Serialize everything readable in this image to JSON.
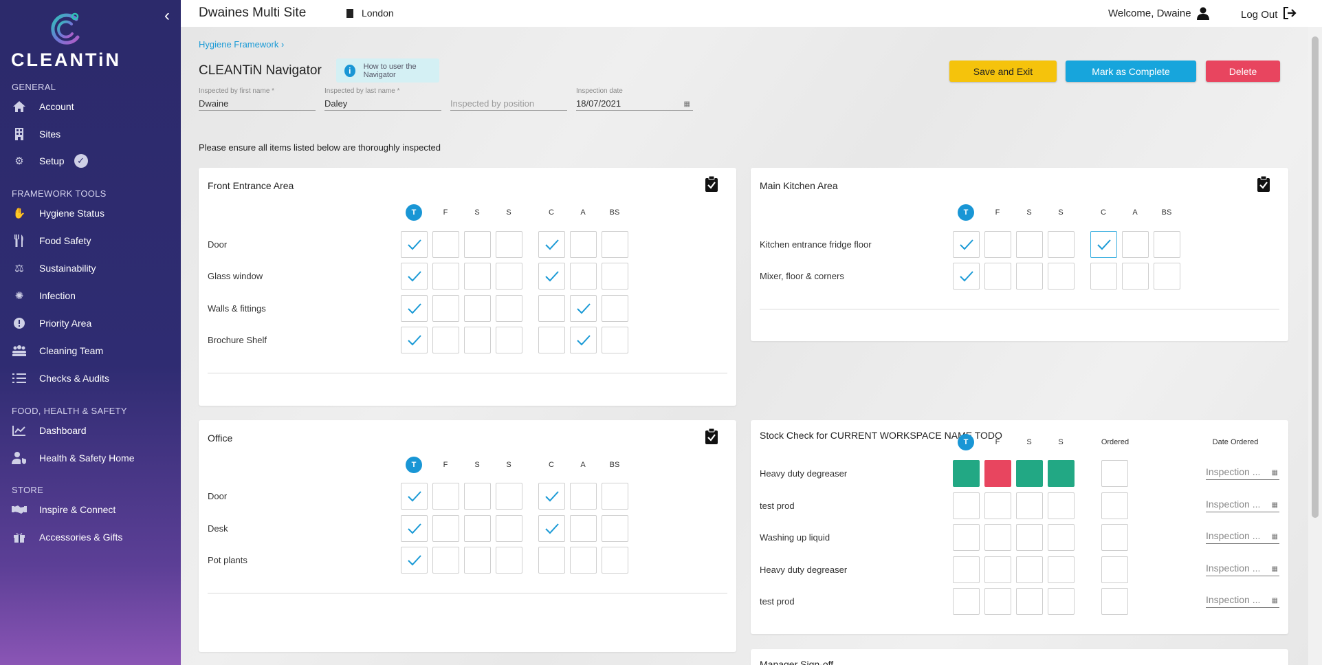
{
  "sidebar": {
    "brand": "CLEANTiN",
    "collapse_icon": "chevron-left-icon",
    "sections": [
      {
        "title": "GENERAL",
        "items": [
          {
            "label": "Account",
            "icon": "home-icon"
          },
          {
            "label": "Sites",
            "icon": "building-icon"
          },
          {
            "label": "Setup",
            "icon": "gear-icon",
            "badge_icon": "check-circle-icon"
          }
        ]
      },
      {
        "title": "FRAMEWORK TOOLS",
        "items": [
          {
            "label": "Hygiene Status",
            "icon": "hand-wash-icon"
          },
          {
            "label": "Food Safety",
            "icon": "cutlery-icon"
          },
          {
            "label": "Sustainability",
            "icon": "scales-icon"
          },
          {
            "label": "Infection",
            "icon": "virus-icon"
          },
          {
            "label": "Priority Area",
            "icon": "alert-icon"
          },
          {
            "label": "Cleaning Team",
            "icon": "team-icon"
          },
          {
            "label": "Checks & Audits",
            "icon": "checklist-icon"
          }
        ]
      },
      {
        "title": "FOOD, HEALTH & SAFETY",
        "items": [
          {
            "label": "Dashboard",
            "icon": "chart-icon"
          },
          {
            "label": "Health & Safety Home",
            "icon": "user-shield-icon"
          }
        ]
      },
      {
        "title": "STORE",
        "items": [
          {
            "label": "Inspire & Connect",
            "icon": "handshake-icon"
          },
          {
            "label": "Accessories & Gifts",
            "icon": "gift-icon"
          }
        ]
      }
    ]
  },
  "topbar": {
    "site_title": "Dwaines Multi Site",
    "location": "London",
    "welcome": "Welcome, Dwaine",
    "logout": "Log Out"
  },
  "page": {
    "breadcrumb": "Hygiene Framework",
    "title": "CLEANTiN Navigator",
    "howto": "How to user the Navigator",
    "buttons": {
      "save": "Save and Exit",
      "complete": "Mark as Complete",
      "delete": "Delete"
    },
    "fields": {
      "first_name": {
        "label": "Inspected by first name *",
        "value": "Dwaine"
      },
      "last_name": {
        "label": "Inspected by last name *",
        "value": "Daley"
      },
      "position": {
        "placeholder": "Inspected by position"
      },
      "date": {
        "label": "Inspection date",
        "value": "18/07/2021"
      }
    },
    "instruction": "Please ensure all items listed below are thoroughly inspected"
  },
  "columns": [
    "T",
    "F",
    "S",
    "S",
    "C",
    "A",
    "BS"
  ],
  "areas": {
    "front": {
      "title": "Front Entrance Area",
      "rows": [
        {
          "label": "Door",
          "checks": [
            1,
            0,
            0,
            0,
            1,
            0,
            0
          ]
        },
        {
          "label": "Glass window",
          "checks": [
            1,
            0,
            0,
            0,
            1,
            0,
            0
          ]
        },
        {
          "label": "Walls & fittings",
          "checks": [
            1,
            0,
            0,
            0,
            0,
            1,
            0
          ]
        },
        {
          "label": "Brochure Shelf",
          "checks": [
            1,
            0,
            0,
            0,
            0,
            1,
            0
          ]
        }
      ]
    },
    "kitchen": {
      "title": "Main Kitchen Area",
      "rows": [
        {
          "label": "Kitchen entrance fridge floor",
          "checks": [
            1,
            0,
            0,
            0,
            1,
            0,
            0
          ]
        },
        {
          "label": "Mixer, floor & corners",
          "checks": [
            1,
            0,
            0,
            0,
            0,
            0,
            0
          ]
        }
      ]
    },
    "office": {
      "title": "Office",
      "rows": [
        {
          "label": "Door",
          "checks": [
            1,
            0,
            0,
            0,
            1,
            0,
            0
          ]
        },
        {
          "label": "Desk",
          "checks": [
            1,
            0,
            0,
            0,
            1,
            0,
            0
          ]
        },
        {
          "label": "Pot plants",
          "checks": [
            1,
            0,
            0,
            0,
            0,
            0,
            0
          ]
        }
      ]
    }
  },
  "stock": {
    "title": "Stock Check for CURRENT WORKSPACE NAME TODO",
    "columns": [
      "T",
      "F",
      "S",
      "S",
      "Ordered",
      "Date Ordered"
    ],
    "date_placeholder": "Inspection ...",
    "colors": {
      "green": "#22a884",
      "red": "#e8455f"
    },
    "rows": [
      {
        "label": "Heavy duty degreaser",
        "status": [
          "green",
          "red",
          "green",
          "green"
        ]
      },
      {
        "label": "test prod",
        "status": [
          "",
          "",
          "",
          ""
        ]
      },
      {
        "label": "Washing up liquid",
        "status": [
          "",
          "",
          "",
          ""
        ]
      },
      {
        "label": "Heavy duty degreaser",
        "status": [
          "",
          "",
          "",
          ""
        ]
      },
      {
        "label": "test prod",
        "status": [
          "",
          "",
          "",
          ""
        ]
      }
    ]
  },
  "next_card": {
    "title": "Manager Sign-off"
  },
  "colors": {
    "accent": "#1996d5",
    "check": "#1a9ad6",
    "save": "#f5c30c",
    "complete": "#17a5dc",
    "delete": "#e8455f"
  }
}
